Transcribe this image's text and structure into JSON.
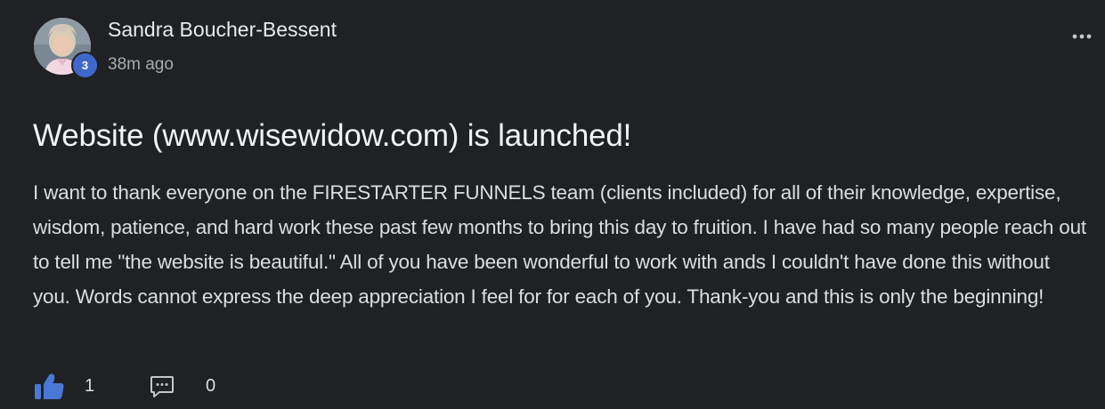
{
  "author": {
    "name": "Sandra Boucher-Bessent",
    "level": "3",
    "timestamp": "38m ago"
  },
  "post": {
    "title": "Website (www.wisewidow.com) is launched!",
    "body": "I want to thank everyone on the FIRESTARTER FUNNELS team (clients included) for all of their knowledge, expertise, wisdom, patience, and hard work these past few months to bring this day to fruition. I have had so many people reach out to tell me \"the website is beautiful.\" All of you have been wonderful to work with ands I couldn't have done this without you. Words cannot express the deep appreciation I feel for for each of you. Thank-you and this is only the beginning!"
  },
  "actions": {
    "like_count": "1",
    "comment_count": "0"
  },
  "icons": {
    "like": "thumbs-up-icon",
    "comment": "comment-icon",
    "more": "more-horizontal-icon"
  },
  "colors": {
    "background": "#202124",
    "accent": "#3f68c9",
    "text": "#e8eaed",
    "muted": "#a9abae"
  }
}
